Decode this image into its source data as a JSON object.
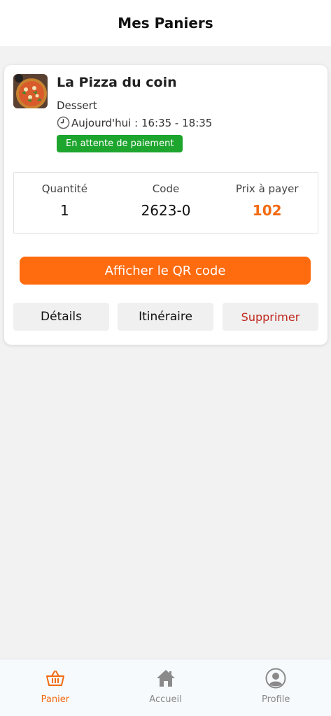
{
  "header": {
    "title": "Mes Paniers"
  },
  "order": {
    "store_name": "La Pizza du coin",
    "category": "Dessert",
    "time": "Aujourd'hui : 16:35 - 18:35",
    "status": "En attente de paiement",
    "quantity_label": "Quantité",
    "quantity_value": "1",
    "code_label": "Code",
    "code_value": "2623-0",
    "price_label": "Prix à payer",
    "price_value": "102",
    "qr_button": "Afficher le QR code",
    "details_button": "Détails",
    "itinerary_button": "Itinéraire",
    "delete_button": "Supprimer"
  },
  "tabbar": {
    "items": [
      {
        "label": "Panier",
        "icon": "basket-icon",
        "active": true
      },
      {
        "label": "Accueil",
        "icon": "home-icon",
        "active": false
      },
      {
        "label": "Profile",
        "icon": "user-icon",
        "active": false
      }
    ]
  },
  "colors": {
    "accent": "#ff6b0f",
    "status_green": "#1ea52e",
    "delete_red": "#c0271b"
  }
}
